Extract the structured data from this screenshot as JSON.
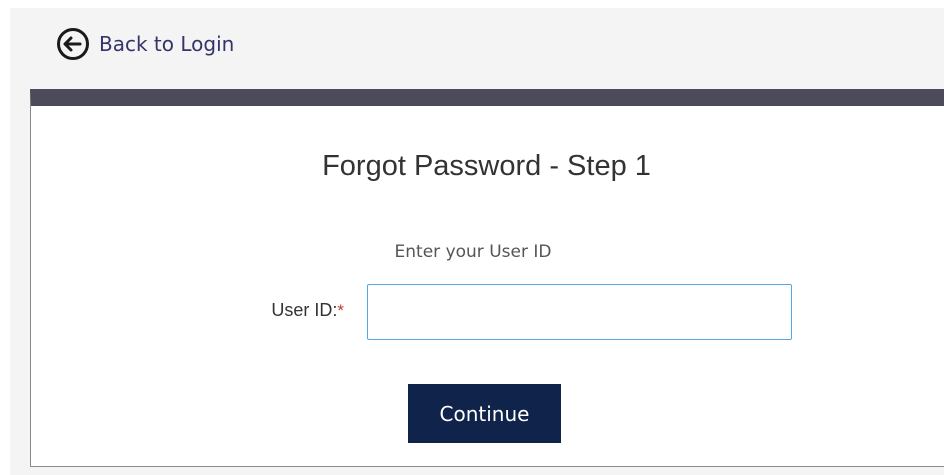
{
  "nav": {
    "back_label": "Back to Login",
    "back_icon": "arrow-left-circle-icon"
  },
  "form": {
    "title": "Forgot Password - Step 1",
    "instruction": "Enter your User ID",
    "user_id_label": "User ID:",
    "required_marker": "*",
    "user_id_value": "",
    "user_id_placeholder": "",
    "submit_label": "Continue"
  },
  "colors": {
    "header_bar": "#4c4b5c",
    "button_bg": "#10234a",
    "link_text": "#34346a",
    "input_border": "#58a6e0",
    "required": "#c0392b"
  }
}
